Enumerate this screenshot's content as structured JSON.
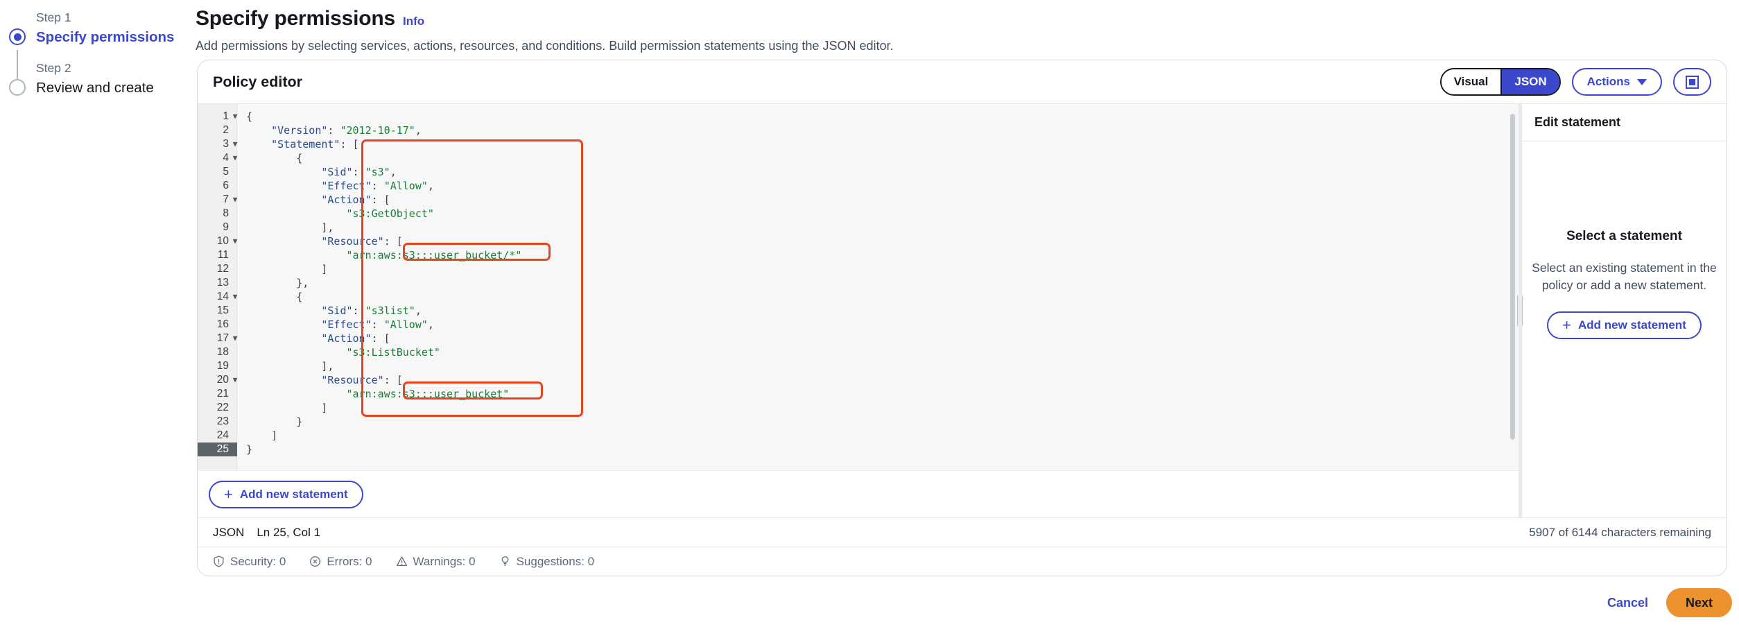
{
  "wizard": {
    "steps": [
      {
        "step_label": "Step 1",
        "title": "Specify permissions",
        "state": "active"
      },
      {
        "step_label": "Step 2",
        "title": "Review and create",
        "state": "inactive"
      }
    ]
  },
  "header": {
    "title": "Specify permissions",
    "info_link": "Info",
    "description": "Add permissions by selecting services, actions, resources, and conditions. Build permission statements using the JSON editor."
  },
  "policy_editor": {
    "title": "Policy editor",
    "view_toggle": {
      "options": [
        "Visual",
        "JSON"
      ],
      "selected": "JSON"
    },
    "actions_button": "Actions",
    "layout_button_icon": "panel-layout-icon",
    "add_statement_button": "Add new statement",
    "code": {
      "language": "JSON",
      "cursor": "Ln 25, Col 1",
      "characters_remaining": "5907 of 6144 characters remaining",
      "active_line": 25,
      "lines": [
        {
          "n": 1,
          "fold": true,
          "text": "{"
        },
        {
          "n": 2,
          "fold": false,
          "text": "    \"Version\": \"2012-10-17\","
        },
        {
          "n": 3,
          "fold": true,
          "text": "    \"Statement\": ["
        },
        {
          "n": 4,
          "fold": true,
          "text": "        {"
        },
        {
          "n": 5,
          "fold": false,
          "text": "            \"Sid\": \"s3\","
        },
        {
          "n": 6,
          "fold": false,
          "text": "            \"Effect\": \"Allow\","
        },
        {
          "n": 7,
          "fold": true,
          "text": "            \"Action\": ["
        },
        {
          "n": 8,
          "fold": false,
          "text": "                \"s3:GetObject\""
        },
        {
          "n": 9,
          "fold": false,
          "text": "            ],"
        },
        {
          "n": 10,
          "fold": true,
          "text": "            \"Resource\": ["
        },
        {
          "n": 11,
          "fold": false,
          "text": "                \"arn:aws:s3:::user_bucket/*\""
        },
        {
          "n": 12,
          "fold": false,
          "text": "            ]"
        },
        {
          "n": 13,
          "fold": false,
          "text": "        },"
        },
        {
          "n": 14,
          "fold": true,
          "text": "        {"
        },
        {
          "n": 15,
          "fold": false,
          "text": "            \"Sid\": \"s3list\","
        },
        {
          "n": 16,
          "fold": false,
          "text": "            \"Effect\": \"Allow\","
        },
        {
          "n": 17,
          "fold": true,
          "text": "            \"Action\": ["
        },
        {
          "n": 18,
          "fold": false,
          "text": "                \"s3:ListBucket\""
        },
        {
          "n": 19,
          "fold": false,
          "text": "            ],"
        },
        {
          "n": 20,
          "fold": true,
          "text": "            \"Resource\": ["
        },
        {
          "n": 21,
          "fold": false,
          "text": "                \"arn:aws:s3:::user_bucket\""
        },
        {
          "n": 22,
          "fold": false,
          "text": "            ]"
        },
        {
          "n": 23,
          "fold": false,
          "text": "        }"
        },
        {
          "n": 24,
          "fold": false,
          "text": "    ]"
        },
        {
          "n": 25,
          "fold": false,
          "text": "}"
        }
      ]
    },
    "diagnostics": [
      {
        "icon": "shield-icon",
        "label": "Security: 0"
      },
      {
        "icon": "error-icon",
        "label": "Errors: 0"
      },
      {
        "icon": "warning-icon",
        "label": "Warnings: 0"
      },
      {
        "icon": "lightbulb-icon",
        "label": "Suggestions: 0"
      }
    ],
    "highlights": {
      "color": "#e8441e",
      "count": 3
    }
  },
  "edit_statement_panel": {
    "header": "Edit statement",
    "empty_title": "Select a statement",
    "empty_text": "Select an existing statement in the policy or add a new statement.",
    "add_button": "Add new statement"
  },
  "footer": {
    "cancel": "Cancel",
    "next": "Next"
  },
  "colors": {
    "accent_blue": "#3b48cc",
    "primary_orange": "#ec912d",
    "highlight_red": "#e8441e",
    "json_key": "#2b4b8f",
    "json_string": "#1a7f37"
  }
}
